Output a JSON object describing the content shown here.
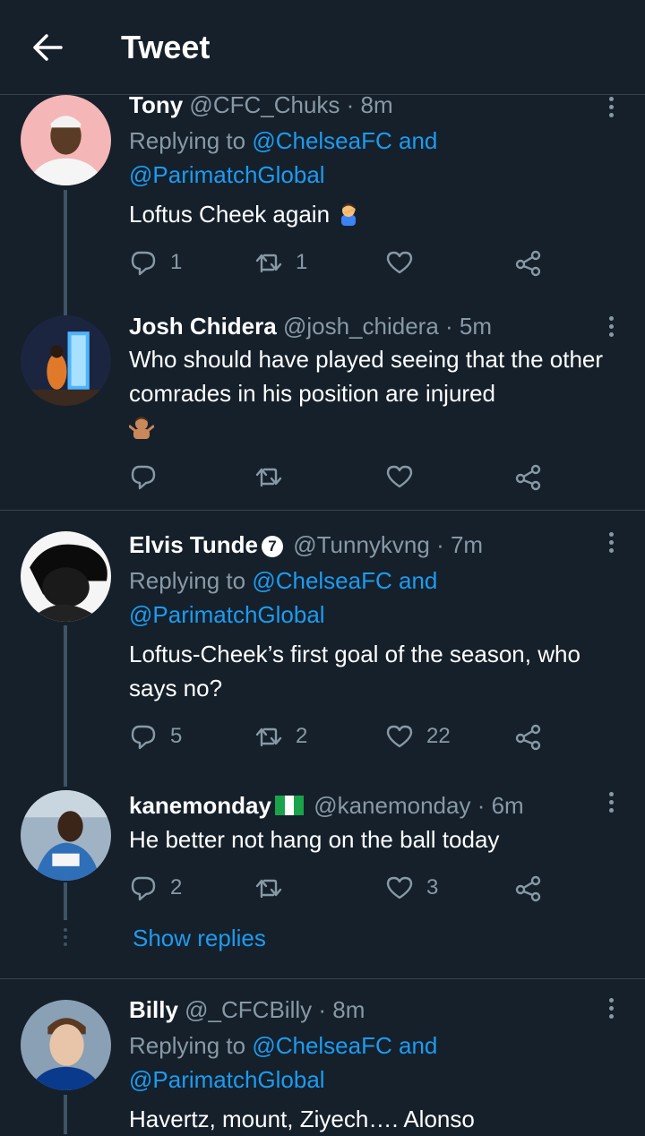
{
  "header": {
    "title": "Tweet"
  },
  "tweets": [
    {
      "name": "Tony",
      "handle": "@CFC_Chuks",
      "time": "· 8m",
      "replying_prefix": "Replying to",
      "replying_mention": "@ChelseaFC and",
      "replying_mention2": "@ParimatchGlobal",
      "text": "Loftus Cheek again",
      "emoji": "man-facepalming",
      "replies": "1",
      "retweets": "1",
      "likes": ""
    },
    {
      "name": "Josh Chidera",
      "handle": "@josh_chidera",
      "time": "· 5m",
      "text": "Who should have played seeing that the other comrades in his position are injured",
      "emoji": "man-shrugging",
      "replies": "",
      "retweets": "",
      "likes": ""
    },
    {
      "name": "Elvis Tunde",
      "badge": "7",
      "handle": "@Tunnykvng",
      "time": "· 7m",
      "replying_prefix": "Replying to",
      "replying_mention": "@ChelseaFC and",
      "replying_mention2": "@ParimatchGlobal",
      "text": "Loftus-Cheek’s first goal of the season, who says no?",
      "replies": "5",
      "retweets": "2",
      "likes": "22"
    },
    {
      "name": "kanemonday",
      "flag": "nigeria-flag",
      "handle": "@kanemonday",
      "time": "· 6m",
      "text": "He better not hang on the ball today",
      "replies": "2",
      "retweets": "",
      "likes": "3"
    },
    {
      "name": "Billy",
      "handle": "@_CFCBilly",
      "time": "· 8m",
      "replying_prefix": "Replying to",
      "replying_mention": "@ChelseaFC and",
      "replying_mention2": "@ParimatchGlobal",
      "text": "Havertz, mount, Ziyech…. Alonso"
    }
  ],
  "show_replies": "Show replies",
  "colors": {
    "background": "#15202b",
    "link": "#1d9bf0",
    "muted": "#8899a6",
    "divider": "#38444d"
  }
}
